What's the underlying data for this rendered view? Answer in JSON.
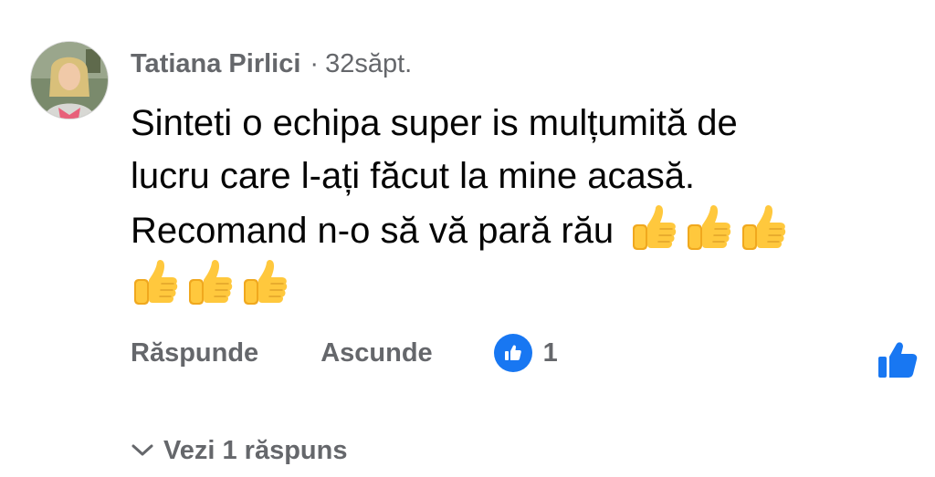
{
  "comment": {
    "author": "Tatiana Pirlici",
    "separator": "·",
    "time": "32săpt.",
    "text_line1": "Sinteti o echipa super is mulțumită de",
    "text_line2": "lucru care l-ați făcut la mine acasă.",
    "text_line3": "Recomand n-o să vă pară rău",
    "emoji": "thumbs-up-icon",
    "emoji_count": 6
  },
  "actions": {
    "reply_label": "Răspunde",
    "hide_label": "Ascunde",
    "like_count": "1"
  },
  "replies": {
    "label": "Vezi 1 răspuns"
  },
  "colors": {
    "meta_text": "#65676b",
    "body_text": "#050505",
    "like_blue": "#1877f2",
    "emoji_yellow": "#ffc83d"
  }
}
